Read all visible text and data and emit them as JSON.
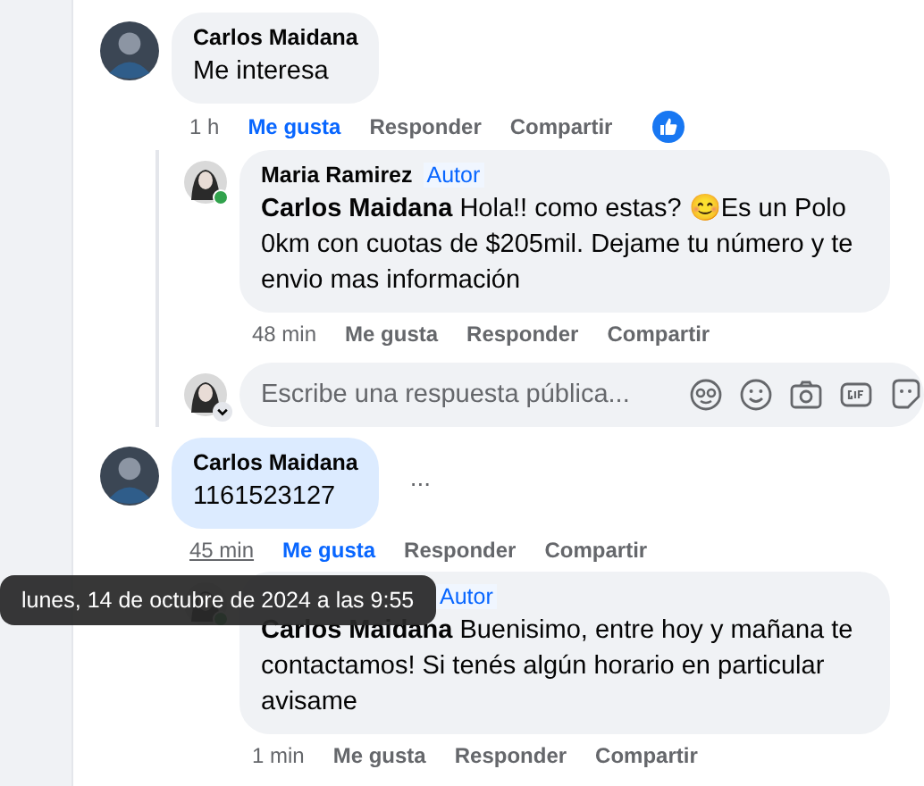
{
  "comments": [
    {
      "author": "Carlos Maidana",
      "text": "Me interesa",
      "time": "1 h",
      "time_underlined": false,
      "highlighted": false,
      "like": "Me gusta",
      "liked": true,
      "reply": "Responder",
      "share": "Compartir",
      "reacted": true,
      "replies": [
        {
          "author": "Maria Ramirez",
          "badge": "Autor",
          "mention": "Carlos Maidana",
          "text": "Hola!! como estas? 😊Es un Polo 0km con cuotas de $205mil. Dejame tu número y te envio mas información",
          "time": "48 min",
          "like": "Me gusta",
          "liked": false,
          "reply": "Responder",
          "share": "Compartir",
          "online": true
        }
      ],
      "reply_box": {
        "placeholder": "Escribe una respuesta pública..."
      }
    },
    {
      "author": "Carlos Maidana",
      "text": "1161523127",
      "time": "45 min",
      "time_underlined": true,
      "highlighted": true,
      "more": "...",
      "like": "Me gusta",
      "liked": true,
      "reply": "Responder",
      "share": "Compartir",
      "reacted": false,
      "replies": [
        {
          "badge": "Autor",
          "mention": "Carlos Maidana",
          "text": "Buenisimo, entre hoy y mañana te contactamos! Si tenés algún horario en particular avisame",
          "time": "1 min",
          "like": "Me gusta",
          "liked": false,
          "reply": "Responder",
          "share": "Compartir",
          "online": true
        }
      ]
    }
  ],
  "tooltip": "lunes, 14 de octubre de 2024 a las 9:55"
}
